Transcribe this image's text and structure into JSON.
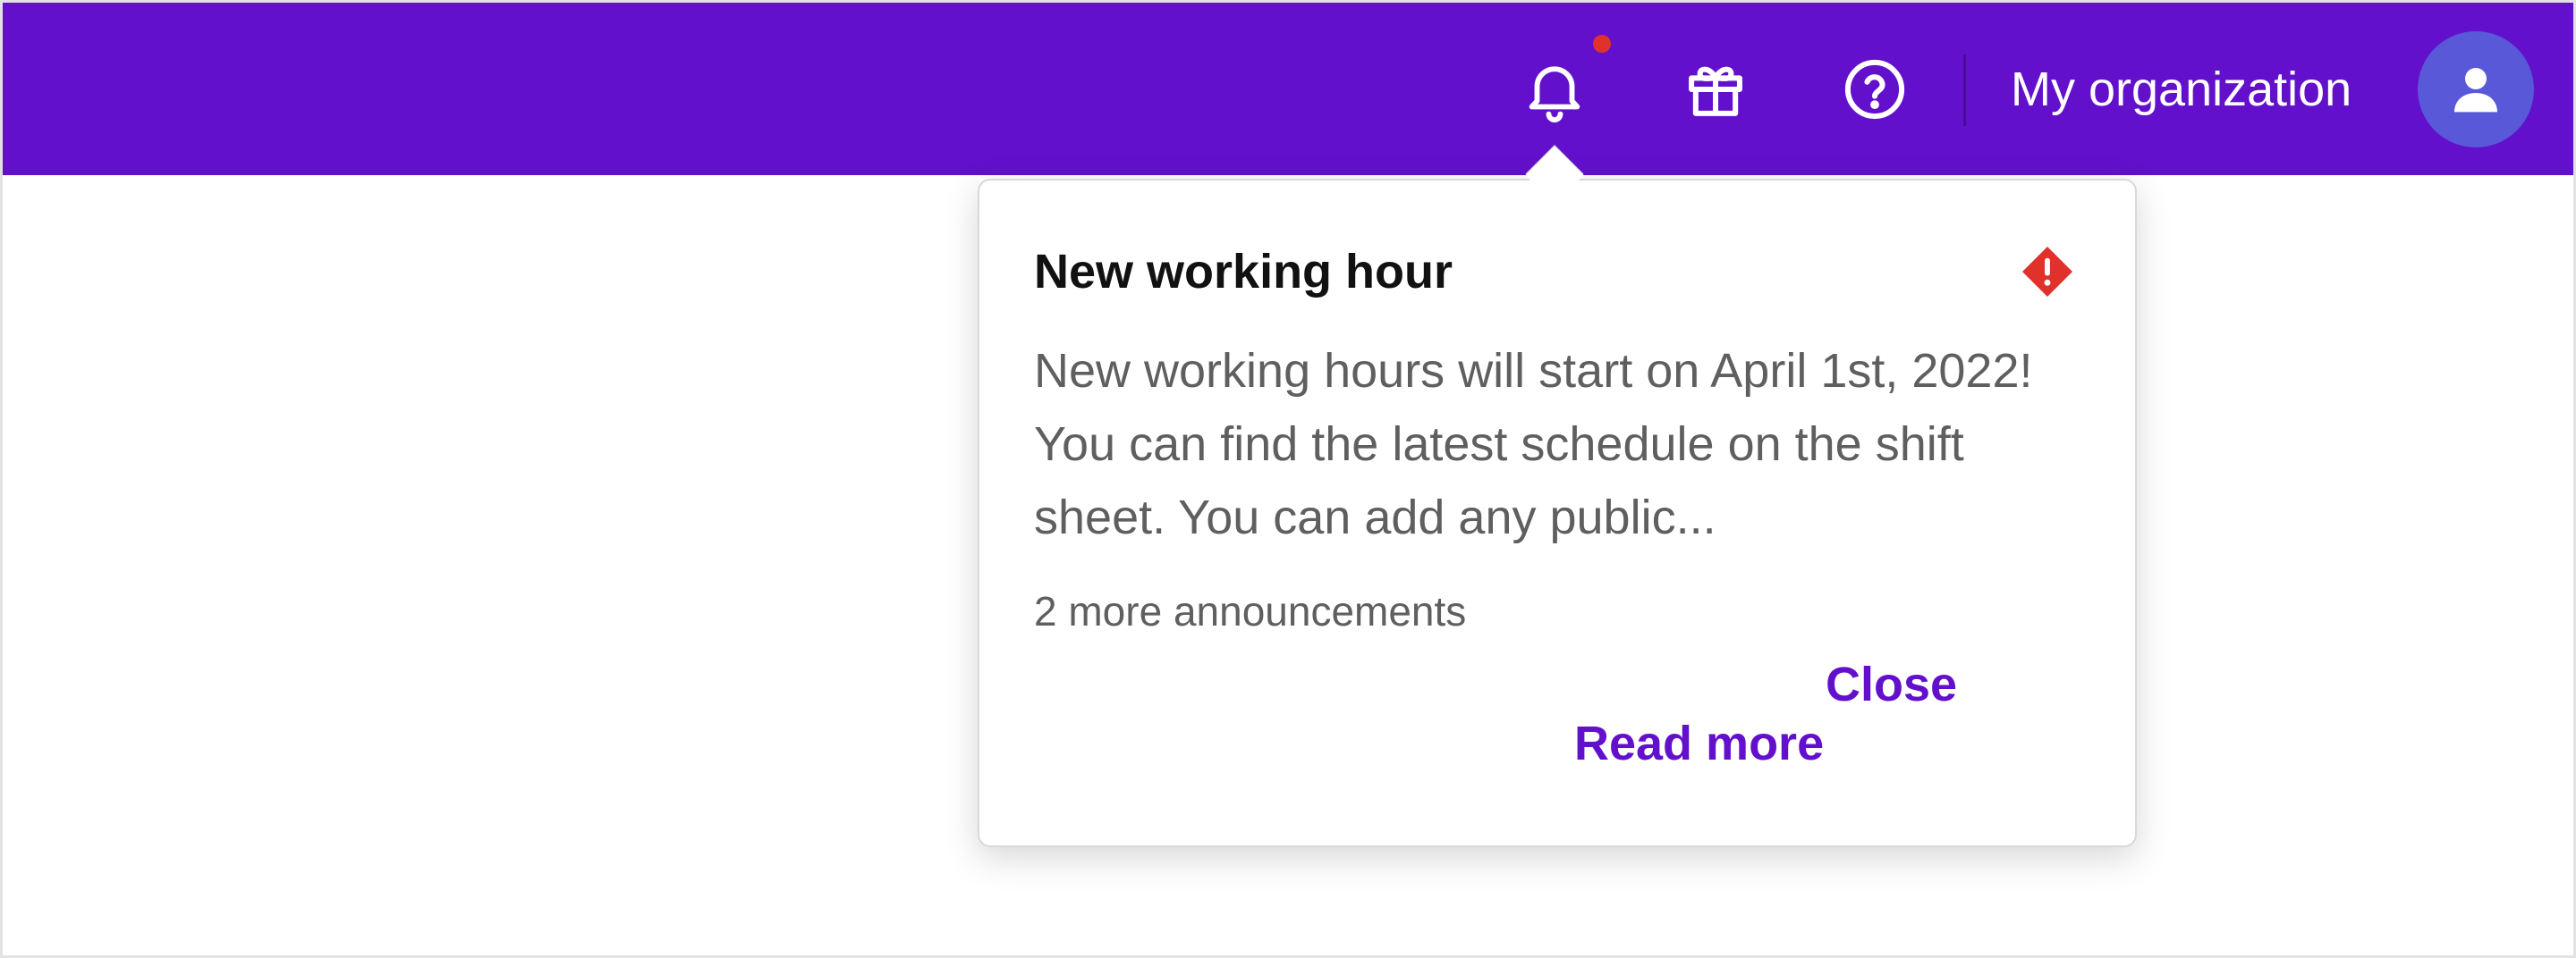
{
  "header": {
    "org_name": "My organization",
    "notification_icon": "bell-icon",
    "gift_icon": "gift-icon",
    "help_icon": "help-circle-icon",
    "avatar_icon": "user-icon",
    "bg_color": "#6310cc",
    "notification_dot_color": "#e0312b"
  },
  "announcement": {
    "title": "New working hour",
    "body": "New working hours will start on April 1st, 2022! You can find the latest schedule on the shift sheet. You can add any public...",
    "more_count": "2 more announcements",
    "close_label": "Close",
    "read_more_label": "Read more",
    "status_icon": "warning-diamond-icon",
    "status_color": "#e0312b",
    "link_color": "#6310cc"
  }
}
